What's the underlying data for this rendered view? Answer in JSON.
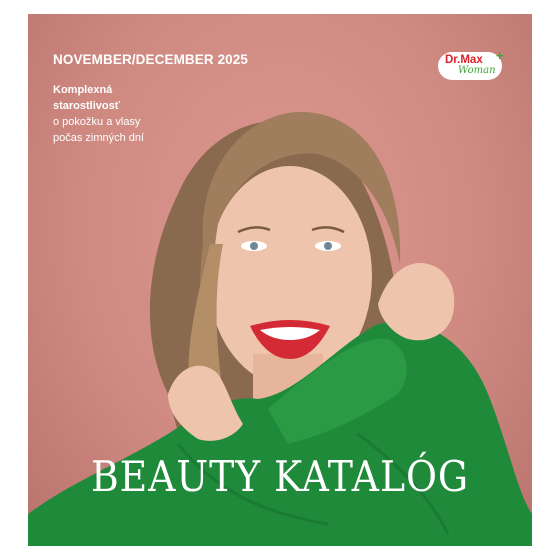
{
  "cover": {
    "issue": "NOVEMBER/DECEMBER 2025",
    "tagline_bold_1": "Komplexná",
    "tagline_bold_2": "starostlivosť",
    "tagline_3": "o pokožku a vlasy",
    "tagline_4": "počas zimných dní",
    "title": "BEAUTY KATALÓG"
  },
  "logo": {
    "brand": "Dr.Max",
    "plus": "+",
    "sub": "Woman"
  },
  "colors": {
    "background": "#d48f88",
    "sweater": "#1f8a3a",
    "logo_red": "#d8232a",
    "logo_green": "#3fa535",
    "text": "#ffffff"
  }
}
